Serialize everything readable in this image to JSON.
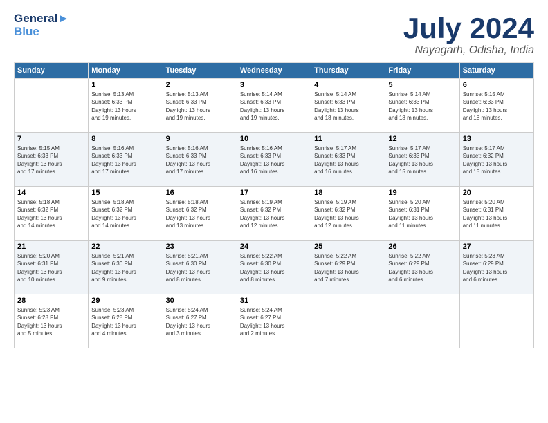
{
  "header": {
    "logo_line1": "General",
    "logo_line2": "Blue",
    "month": "July 2024",
    "location": "Nayagarh, Odisha, India"
  },
  "weekdays": [
    "Sunday",
    "Monday",
    "Tuesday",
    "Wednesday",
    "Thursday",
    "Friday",
    "Saturday"
  ],
  "weeks": [
    [
      {
        "day": "",
        "info": ""
      },
      {
        "day": "1",
        "info": "Sunrise: 5:13 AM\nSunset: 6:33 PM\nDaylight: 13 hours\nand 19 minutes."
      },
      {
        "day": "2",
        "info": "Sunrise: 5:13 AM\nSunset: 6:33 PM\nDaylight: 13 hours\nand 19 minutes."
      },
      {
        "day": "3",
        "info": "Sunrise: 5:14 AM\nSunset: 6:33 PM\nDaylight: 13 hours\nand 19 minutes."
      },
      {
        "day": "4",
        "info": "Sunrise: 5:14 AM\nSunset: 6:33 PM\nDaylight: 13 hours\nand 18 minutes."
      },
      {
        "day": "5",
        "info": "Sunrise: 5:14 AM\nSunset: 6:33 PM\nDaylight: 13 hours\nand 18 minutes."
      },
      {
        "day": "6",
        "info": "Sunrise: 5:15 AM\nSunset: 6:33 PM\nDaylight: 13 hours\nand 18 minutes."
      }
    ],
    [
      {
        "day": "7",
        "info": "Sunrise: 5:15 AM\nSunset: 6:33 PM\nDaylight: 13 hours\nand 17 minutes."
      },
      {
        "day": "8",
        "info": "Sunrise: 5:16 AM\nSunset: 6:33 PM\nDaylight: 13 hours\nand 17 minutes."
      },
      {
        "day": "9",
        "info": "Sunrise: 5:16 AM\nSunset: 6:33 PM\nDaylight: 13 hours\nand 17 minutes."
      },
      {
        "day": "10",
        "info": "Sunrise: 5:16 AM\nSunset: 6:33 PM\nDaylight: 13 hours\nand 16 minutes."
      },
      {
        "day": "11",
        "info": "Sunrise: 5:17 AM\nSunset: 6:33 PM\nDaylight: 13 hours\nand 16 minutes."
      },
      {
        "day": "12",
        "info": "Sunrise: 5:17 AM\nSunset: 6:33 PM\nDaylight: 13 hours\nand 15 minutes."
      },
      {
        "day": "13",
        "info": "Sunrise: 5:17 AM\nSunset: 6:32 PM\nDaylight: 13 hours\nand 15 minutes."
      }
    ],
    [
      {
        "day": "14",
        "info": "Sunrise: 5:18 AM\nSunset: 6:32 PM\nDaylight: 13 hours\nand 14 minutes."
      },
      {
        "day": "15",
        "info": "Sunrise: 5:18 AM\nSunset: 6:32 PM\nDaylight: 13 hours\nand 14 minutes."
      },
      {
        "day": "16",
        "info": "Sunrise: 5:18 AM\nSunset: 6:32 PM\nDaylight: 13 hours\nand 13 minutes."
      },
      {
        "day": "17",
        "info": "Sunrise: 5:19 AM\nSunset: 6:32 PM\nDaylight: 13 hours\nand 12 minutes."
      },
      {
        "day": "18",
        "info": "Sunrise: 5:19 AM\nSunset: 6:32 PM\nDaylight: 13 hours\nand 12 minutes."
      },
      {
        "day": "19",
        "info": "Sunrise: 5:20 AM\nSunset: 6:31 PM\nDaylight: 13 hours\nand 11 minutes."
      },
      {
        "day": "20",
        "info": "Sunrise: 5:20 AM\nSunset: 6:31 PM\nDaylight: 13 hours\nand 11 minutes."
      }
    ],
    [
      {
        "day": "21",
        "info": "Sunrise: 5:20 AM\nSunset: 6:31 PM\nDaylight: 13 hours\nand 10 minutes."
      },
      {
        "day": "22",
        "info": "Sunrise: 5:21 AM\nSunset: 6:30 PM\nDaylight: 13 hours\nand 9 minutes."
      },
      {
        "day": "23",
        "info": "Sunrise: 5:21 AM\nSunset: 6:30 PM\nDaylight: 13 hours\nand 8 minutes."
      },
      {
        "day": "24",
        "info": "Sunrise: 5:22 AM\nSunset: 6:30 PM\nDaylight: 13 hours\nand 8 minutes."
      },
      {
        "day": "25",
        "info": "Sunrise: 5:22 AM\nSunset: 6:29 PM\nDaylight: 13 hours\nand 7 minutes."
      },
      {
        "day": "26",
        "info": "Sunrise: 5:22 AM\nSunset: 6:29 PM\nDaylight: 13 hours\nand 6 minutes."
      },
      {
        "day": "27",
        "info": "Sunrise: 5:23 AM\nSunset: 6:29 PM\nDaylight: 13 hours\nand 6 minutes."
      }
    ],
    [
      {
        "day": "28",
        "info": "Sunrise: 5:23 AM\nSunset: 6:28 PM\nDaylight: 13 hours\nand 5 minutes."
      },
      {
        "day": "29",
        "info": "Sunrise: 5:23 AM\nSunset: 6:28 PM\nDaylight: 13 hours\nand 4 minutes."
      },
      {
        "day": "30",
        "info": "Sunrise: 5:24 AM\nSunset: 6:27 PM\nDaylight: 13 hours\nand 3 minutes."
      },
      {
        "day": "31",
        "info": "Sunrise: 5:24 AM\nSunset: 6:27 PM\nDaylight: 13 hours\nand 2 minutes."
      },
      {
        "day": "",
        "info": ""
      },
      {
        "day": "",
        "info": ""
      },
      {
        "day": "",
        "info": ""
      }
    ]
  ]
}
